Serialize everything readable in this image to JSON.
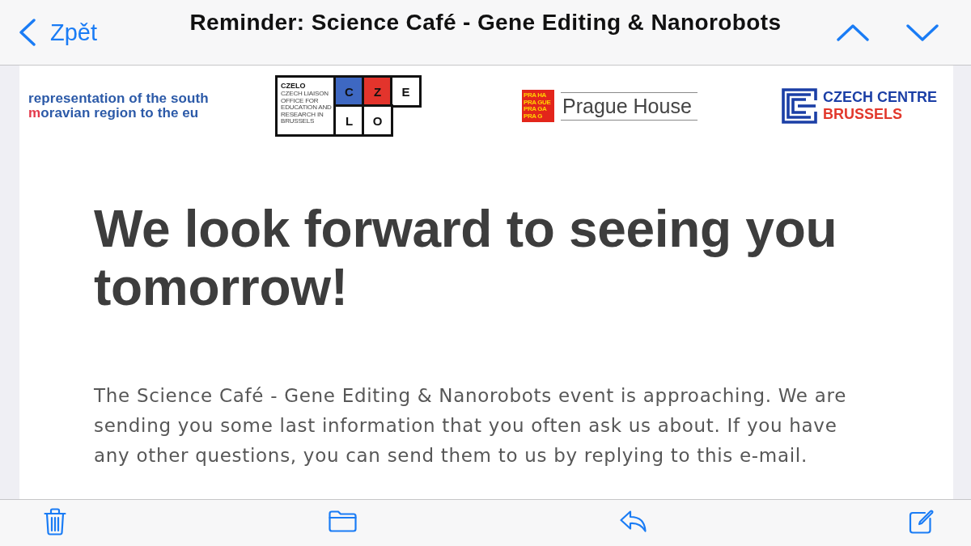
{
  "nav_bar": {
    "back_label": "Zpět",
    "title": "Reminder: Science Café - Gene Editing & Nanorobots"
  },
  "logos": [
    {
      "kind": "region",
      "line_1": "representation of the south",
      "accent": "m",
      "line_2": "oravian region to the eu"
    },
    {
      "kind": "czelo",
      "name": "CZELO",
      "description": "CZECH LIAISON OFFICE FOR EDUCATION AND RESEARCH IN BRUSSELS",
      "tiles": [
        {
          "letter": "C",
          "color": "#3e68c2"
        },
        {
          "letter": "Z",
          "color": "#e3342c"
        },
        {
          "letter": "E",
          "color": "#ffffff"
        },
        {
          "letter": "L",
          "color": "#ffffff"
        },
        {
          "letter": "O",
          "color": "#ffffff"
        }
      ]
    },
    {
      "kind": "house",
      "badge_lines": [
        "PRA HA",
        "PRA GUE",
        "PRA GA",
        "PRA G"
      ],
      "name": "Prague House"
    },
    {
      "kind": "centre",
      "line_1": "CZECH CENTRE",
      "line_2": "BRUSSELS"
    }
  ],
  "heading": "We look forward to seeing you tomorrow!",
  "body": "The Science Café - Gene Editing & Nanorobots event is approaching. We are sending you some last information that you often ask us about. If you have any other questions, you can send them to us by replying to this e-mail."
}
